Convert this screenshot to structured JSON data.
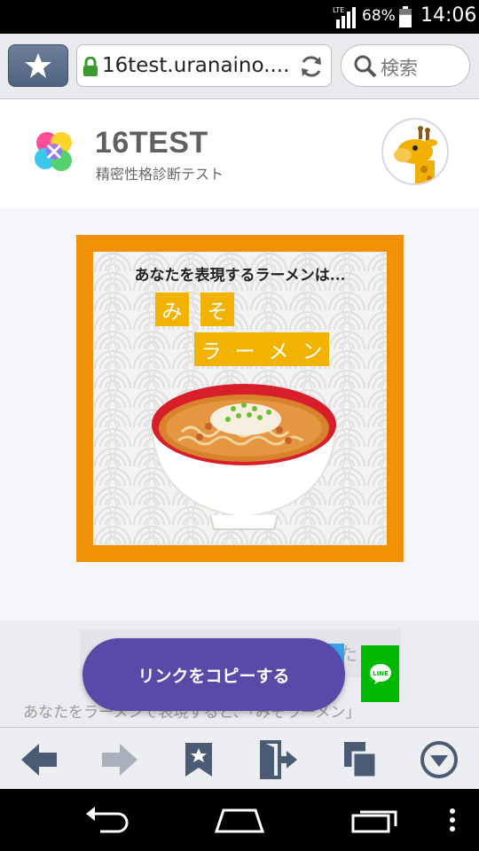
{
  "status_bar": {
    "network": "LTE",
    "battery_percent": "68%",
    "battery_level": 0.68,
    "time": "14:06"
  },
  "browser": {
    "url": "16test.uranaino....",
    "search_label": "検索"
  },
  "site": {
    "title": "16TEST",
    "subtitle": "精密性格診断テスト"
  },
  "result": {
    "caption": "あなたを表現するラーメンは...",
    "name_chars": [
      "み",
      "そ"
    ],
    "type_chars": [
      "ラ",
      "ー",
      "メ",
      "ン"
    ]
  },
  "share": {
    "copy_button_label": "リンクをコピーする",
    "strip_text": "あなた",
    "description": "あなたをラーメンで表現すると、「みそラーメン」",
    "line_label": "LINE"
  },
  "colors": {
    "accent_orange": "#f39106",
    "tile_yellow": "#f2b200",
    "copy_button": "#5a4aa8",
    "line_green": "#00b900",
    "toolbar_icon": "#4b5b73"
  },
  "icons": {
    "bookmark": "star-icon",
    "lock": "lock-icon",
    "reload": "reload-icon",
    "search": "search-icon",
    "back": "back-arrow-icon",
    "forward": "forward-arrow-icon",
    "bookmarks": "bookmark-icon",
    "exit": "exit-door-icon",
    "tabs": "tabs-icon",
    "menu": "menu-down-icon"
  }
}
